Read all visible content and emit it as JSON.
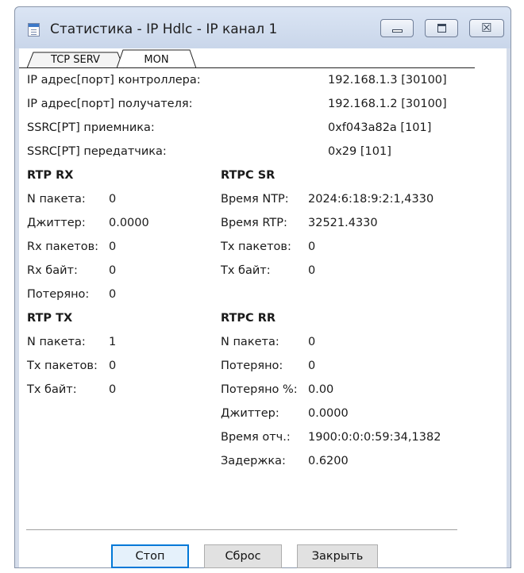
{
  "window": {
    "title": "Статистика - IP Hdlc - IP канал 1",
    "icons": {
      "app": "document-icon",
      "minimize": "minimize-icon",
      "restore": "restore-icon",
      "close": "close-icon",
      "close_glyph": "☒"
    }
  },
  "tabs": [
    {
      "label": "TCP SERV",
      "active": false
    },
    {
      "label": "MON",
      "active": true
    }
  ],
  "info": [
    {
      "label": "IP адрес[порт] контроллера:",
      "value": "192.168.1.3 [30100]"
    },
    {
      "label": "IP адрес[порт] получателя:",
      "value": "192.168.1.2 [30100]"
    },
    {
      "label": "SSRC[PT] приемника:",
      "value": "0xf043a82a [101]"
    },
    {
      "label": "SSRC[PT] передатчика:",
      "value": "0x29 [101]"
    }
  ],
  "rtp_rx": {
    "title": "RTP RX",
    "rows": [
      {
        "label": "N пакета:",
        "value": "0"
      },
      {
        "label": "Джиттер:",
        "value": "0.0000"
      },
      {
        "label": "Rx пакетов:",
        "value": "0"
      },
      {
        "label": "Rx байт:",
        "value": "0"
      },
      {
        "label": "Потеряно:",
        "value": "0"
      }
    ]
  },
  "rtpc_sr": {
    "title": "RTPC SR",
    "rows": [
      {
        "label": "Время NTP:",
        "value": "2024:6:18:9:2:1,4330"
      },
      {
        "label": "Время RTP:",
        "value": "32521.4330"
      },
      {
        "label": "Tx пакетов:",
        "value": "0"
      },
      {
        "label": "Tx байт:",
        "value": "0"
      }
    ]
  },
  "rtp_tx": {
    "title": "RTP TX",
    "rows": [
      {
        "label": "N пакета:",
        "value": "1"
      },
      {
        "label": "Tx пакетов:",
        "value": "0"
      },
      {
        "label": "Tx байт:",
        "value": "0"
      }
    ]
  },
  "rtpc_rr": {
    "title": "RTPC RR",
    "rows": [
      {
        "label": "N пакета:",
        "value": "0"
      },
      {
        "label": "Потеряно:",
        "value": "0"
      },
      {
        "label": "Потеряно %:",
        "value": "0.00"
      },
      {
        "label": "Джиттер:",
        "value": "0.0000"
      },
      {
        "label": "Время отч.:",
        "value": "1900:0:0:0:59:34,1382"
      },
      {
        "label": "Задержка:",
        "value": "0.6200"
      }
    ]
  },
  "buttons": {
    "stop": "Стоп",
    "reset": "Сброс",
    "close": "Закрыть"
  }
}
